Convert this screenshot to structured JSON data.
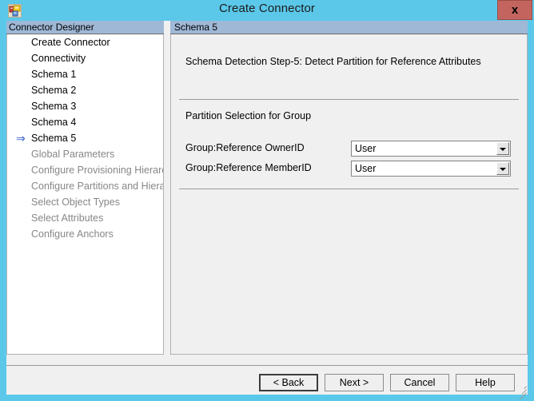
{
  "window": {
    "title": "Create Connector",
    "icon": "connector-designer-icon",
    "close_label": "x",
    "frame_color": "#5bc8ea",
    "client_color": "#f0f0f0"
  },
  "tree_panel": {
    "header": "Connector Designer",
    "current_marker": "⇒",
    "items": [
      {
        "label": "Create Connector",
        "state": "enabled",
        "current": false
      },
      {
        "label": "Connectivity",
        "state": "enabled",
        "current": false
      },
      {
        "label": "Schema 1",
        "state": "enabled",
        "current": false
      },
      {
        "label": "Schema 2",
        "state": "enabled",
        "current": false
      },
      {
        "label": "Schema 3",
        "state": "enabled",
        "current": false
      },
      {
        "label": "Schema 4",
        "state": "enabled",
        "current": false
      },
      {
        "label": "Schema 5",
        "state": "enabled",
        "current": true
      },
      {
        "label": "Global Parameters",
        "state": "disabled",
        "current": false
      },
      {
        "label": "Configure Provisioning Hierarchy",
        "state": "disabled",
        "current": false
      },
      {
        "label": "Configure Partitions and Hierarchies",
        "state": "disabled",
        "current": false
      },
      {
        "label": "Select Object Types",
        "state": "disabled",
        "current": false
      },
      {
        "label": "Select Attributes",
        "state": "disabled",
        "current": false
      },
      {
        "label": "Configure Anchors",
        "state": "disabled",
        "current": false
      }
    ]
  },
  "content_panel": {
    "header": "Schema 5",
    "step_title": "Schema Detection Step-5: Detect Partition for Reference Attributes",
    "section_title": "Partition Selection for Group",
    "fields": [
      {
        "label": "Group:Reference OwnerID",
        "value": "User"
      },
      {
        "label": "Group:Reference MemberID",
        "value": "User"
      }
    ]
  },
  "buttons": {
    "back": "< Back",
    "next": "Next  >",
    "cancel": "Cancel",
    "help": "Help"
  }
}
